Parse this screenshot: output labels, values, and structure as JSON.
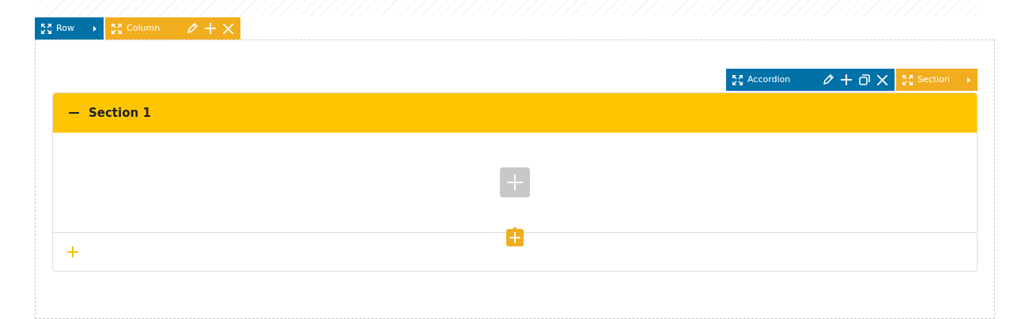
{
  "row_toolbar": {
    "label": "Row"
  },
  "column_toolbar": {
    "label": "Column"
  },
  "accordion_toolbar": {
    "label": "Accordion"
  },
  "section_toolbar": {
    "label": "Section"
  },
  "accordion": {
    "sections": [
      {
        "title": "Section 1",
        "expanded": true
      }
    ]
  }
}
